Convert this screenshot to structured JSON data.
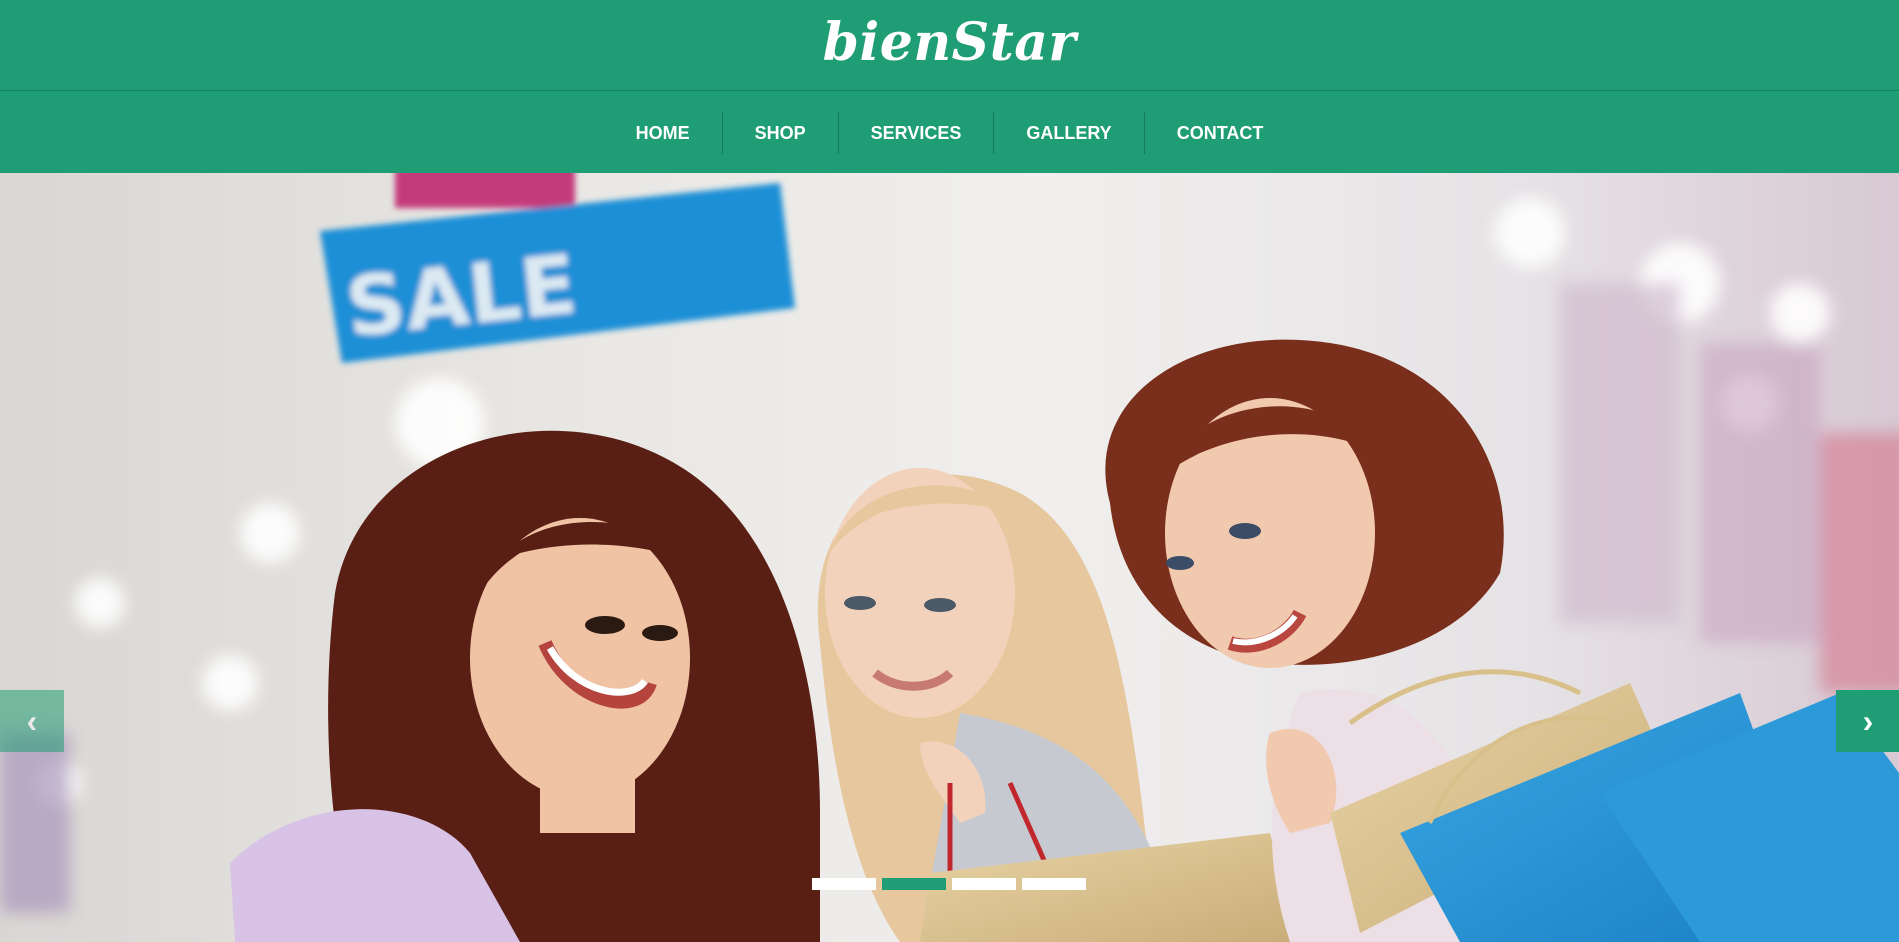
{
  "brand": {
    "logo_text": "bienStar"
  },
  "nav": {
    "items": [
      {
        "label": "HOME"
      },
      {
        "label": "SHOP"
      },
      {
        "label": "SERVICES"
      },
      {
        "label": "GALLERY"
      },
      {
        "label": "CONTACT"
      }
    ]
  },
  "hero": {
    "sign_text": "SALE",
    "prev_icon": "‹",
    "next_icon": "›",
    "slides_count": 4,
    "active_slide": 2
  },
  "colors": {
    "brand_green": "#1f9d74",
    "white": "#ffffff"
  }
}
